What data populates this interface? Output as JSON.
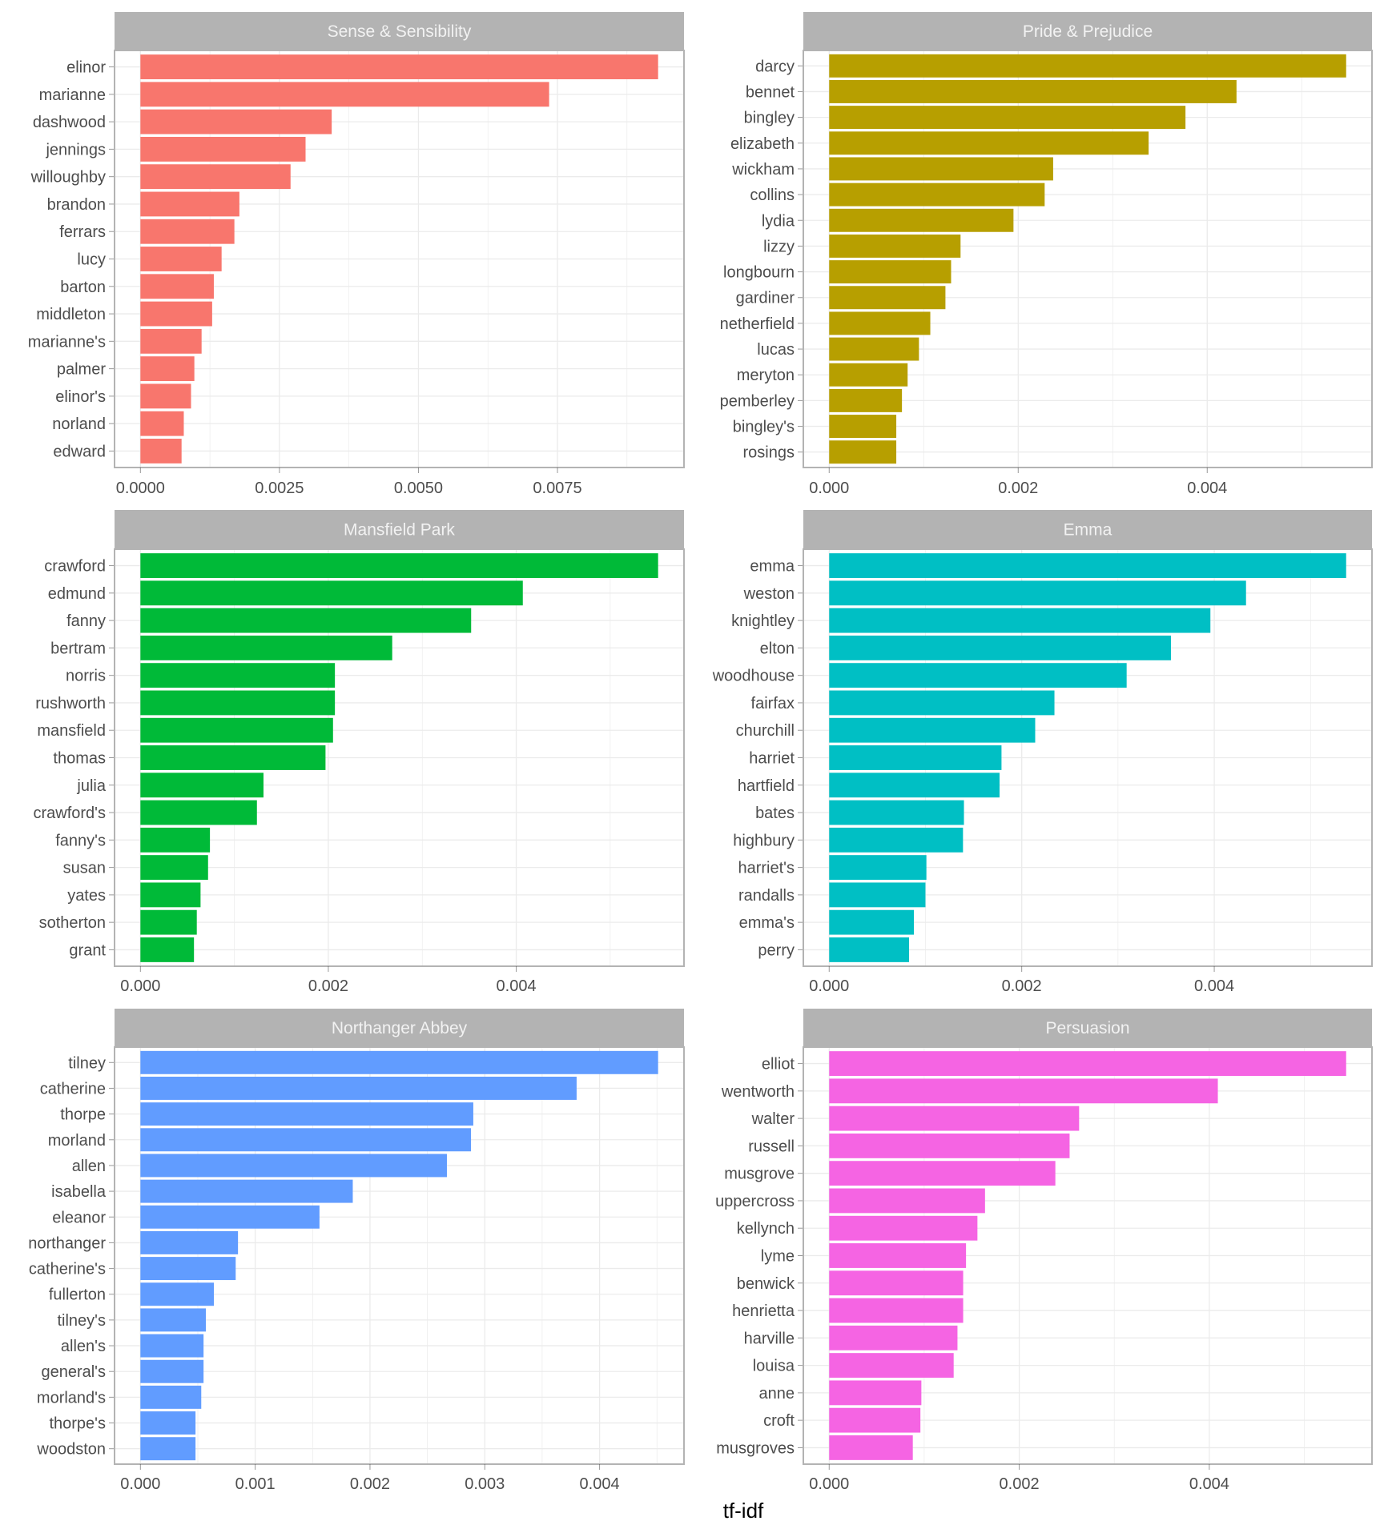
{
  "chart_data": {
    "type": "bar",
    "orientation": "horizontal",
    "facet_layout": "2 columns x 3 rows, free scales",
    "xlabel": "tf-idf",
    "ylabel": "",
    "grid": true,
    "legend": "none",
    "panels": [
      {
        "title": "Sense & Sensibility",
        "color": "#F8766D",
        "xticks": [
          0,
          0.0025,
          0.005,
          0.0075
        ],
        "xtick_labels": [
          "0.0000",
          "0.0025",
          "0.0050",
          "0.0075"
        ],
        "categories": [
          "elinor",
          "marianne",
          "dashwood",
          "jennings",
          "willoughby",
          "brandon",
          "ferrars",
          "lucy",
          "barton",
          "middleton",
          "marianne's",
          "palmer",
          "elinor's",
          "norland",
          "edward"
        ],
        "values": [
          0.00931,
          0.00735,
          0.00344,
          0.00297,
          0.0027,
          0.00178,
          0.00169,
          0.00146,
          0.00132,
          0.00129,
          0.0011,
          0.00097,
          0.00091,
          0.00078,
          0.00074
        ]
      },
      {
        "title": "Pride & Prejudice",
        "color": "#B79F00",
        "xticks": [
          0,
          0.002,
          0.004
        ],
        "xtick_labels": [
          "0.000",
          "0.002",
          "0.004"
        ],
        "categories": [
          "darcy",
          "bennet",
          "bingley",
          "elizabeth",
          "wickham",
          "collins",
          "lydia",
          "lizzy",
          "longbourn",
          "gardiner",
          "netherfield",
          "lucas",
          "meryton",
          "pemberley",
          "bingley's",
          "rosings"
        ],
        "values": [
          0.00547,
          0.00431,
          0.00377,
          0.00338,
          0.00237,
          0.00228,
          0.00195,
          0.00139,
          0.00129,
          0.00123,
          0.00107,
          0.00095,
          0.00083,
          0.00077,
          0.00071,
          0.00071
        ]
      },
      {
        "title": "Mansfield Park",
        "color": "#00BA38",
        "xticks": [
          0,
          0.002,
          0.004
        ],
        "xtick_labels": [
          "0.000",
          "0.002",
          "0.004"
        ],
        "categories": [
          "crawford",
          "edmund",
          "fanny",
          "bertram",
          "norris",
          "rushworth",
          "mansfield",
          "thomas",
          "julia",
          "crawford's",
          "fanny's",
          "susan",
          "yates",
          "sotherton",
          "grant"
        ],
        "values": [
          0.00551,
          0.00407,
          0.00352,
          0.00268,
          0.00207,
          0.00207,
          0.00205,
          0.00197,
          0.00131,
          0.00124,
          0.00074,
          0.00072,
          0.00064,
          0.0006,
          0.00057
        ]
      },
      {
        "title": "Emma",
        "color": "#00BFC4",
        "xticks": [
          0,
          0.002,
          0.004
        ],
        "xtick_labels": [
          "0.000",
          "0.002",
          "0.004"
        ],
        "categories": [
          "emma",
          "weston",
          "knightley",
          "elton",
          "woodhouse",
          "fairfax",
          "churchill",
          "harriet",
          "hartfield",
          "bates",
          "highbury",
          "harriet's",
          "randalls",
          "emma's",
          "perry"
        ],
        "values": [
          0.00537,
          0.00433,
          0.00396,
          0.00355,
          0.00309,
          0.00234,
          0.00214,
          0.00179,
          0.00177,
          0.0014,
          0.00139,
          0.00101,
          0.001,
          0.00088,
          0.00083
        ]
      },
      {
        "title": "Northanger Abbey",
        "color": "#619CFF",
        "xticks": [
          0,
          0.001,
          0.002,
          0.003,
          0.004
        ],
        "xtick_labels": [
          "0.000",
          "0.001",
          "0.002",
          "0.003",
          "0.004"
        ],
        "categories": [
          "tilney",
          "catherine",
          "thorpe",
          "morland",
          "allen",
          "isabella",
          "eleanor",
          "northanger",
          "catherine's",
          "fullerton",
          "tilney's",
          "allen's",
          "general's",
          "morland's",
          "thorpe's",
          "woodston"
        ],
        "values": [
          0.00451,
          0.0038,
          0.0029,
          0.00288,
          0.00267,
          0.00185,
          0.00156,
          0.00085,
          0.00083,
          0.00064,
          0.00057,
          0.00055,
          0.00055,
          0.00053,
          0.00048,
          0.00048
        ]
      },
      {
        "title": "Persuasion",
        "color": "#F564E3",
        "xticks": [
          0,
          0.002,
          0.004
        ],
        "xtick_labels": [
          "0.000",
          "0.002",
          "0.004"
        ],
        "categories": [
          "elliot",
          "wentworth",
          "walter",
          "russell",
          "musgrove",
          "uppercross",
          "kellynch",
          "lyme",
          "benwick",
          "henrietta",
          "harville",
          "louisa",
          "anne",
          "croft",
          "musgroves"
        ],
        "values": [
          0.00544,
          0.00409,
          0.00263,
          0.00253,
          0.00238,
          0.00164,
          0.00156,
          0.00144,
          0.00141,
          0.00141,
          0.00135,
          0.00131,
          0.00097,
          0.00096,
          0.00088
        ]
      }
    ]
  }
}
